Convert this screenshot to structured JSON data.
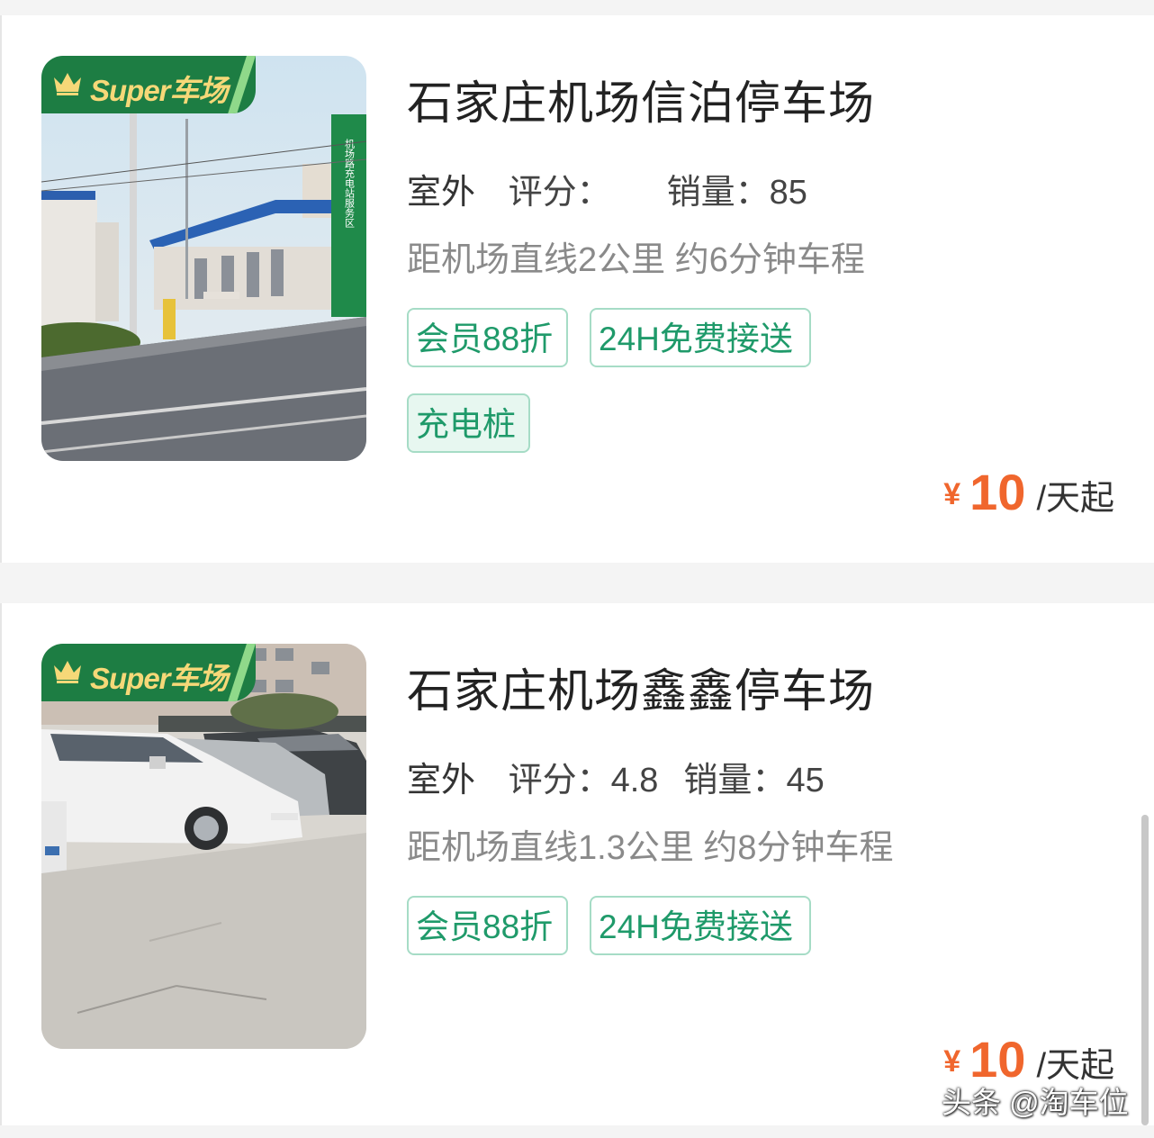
{
  "listings": [
    {
      "badge": "Super车场",
      "title": "石家庄机场信泊停车场",
      "type": "室外",
      "rating_label": "评分：",
      "rating": "",
      "sales_label": "销量：",
      "sales": "85",
      "distance": "距机场直线2公里 约6分钟车程",
      "tags": [
        "会员88折",
        "24H免费接送",
        "充电桩"
      ],
      "price_symbol": "¥",
      "price": "10",
      "price_unit": "/天起"
    },
    {
      "badge": "Super车场",
      "title": "石家庄机场鑫鑫停车场",
      "type": "室外",
      "rating_label": "评分：",
      "rating": "4.8",
      "sales_label": "销量：",
      "sales": "45",
      "distance": "距机场直线1.3公里 约8分钟车程",
      "tags": [
        "会员88折",
        "24H免费接送"
      ],
      "price_symbol": "¥",
      "price": "10",
      "price_unit": "/天起"
    }
  ],
  "sign_text": "机场路充电站服务区",
  "watermark": "头条 @淘车位",
  "colors": {
    "badge_green": "#1d7d43",
    "badge_text": "#f6d878",
    "tag_green": "#1f9a6a",
    "price_orange": "#f0662d"
  }
}
